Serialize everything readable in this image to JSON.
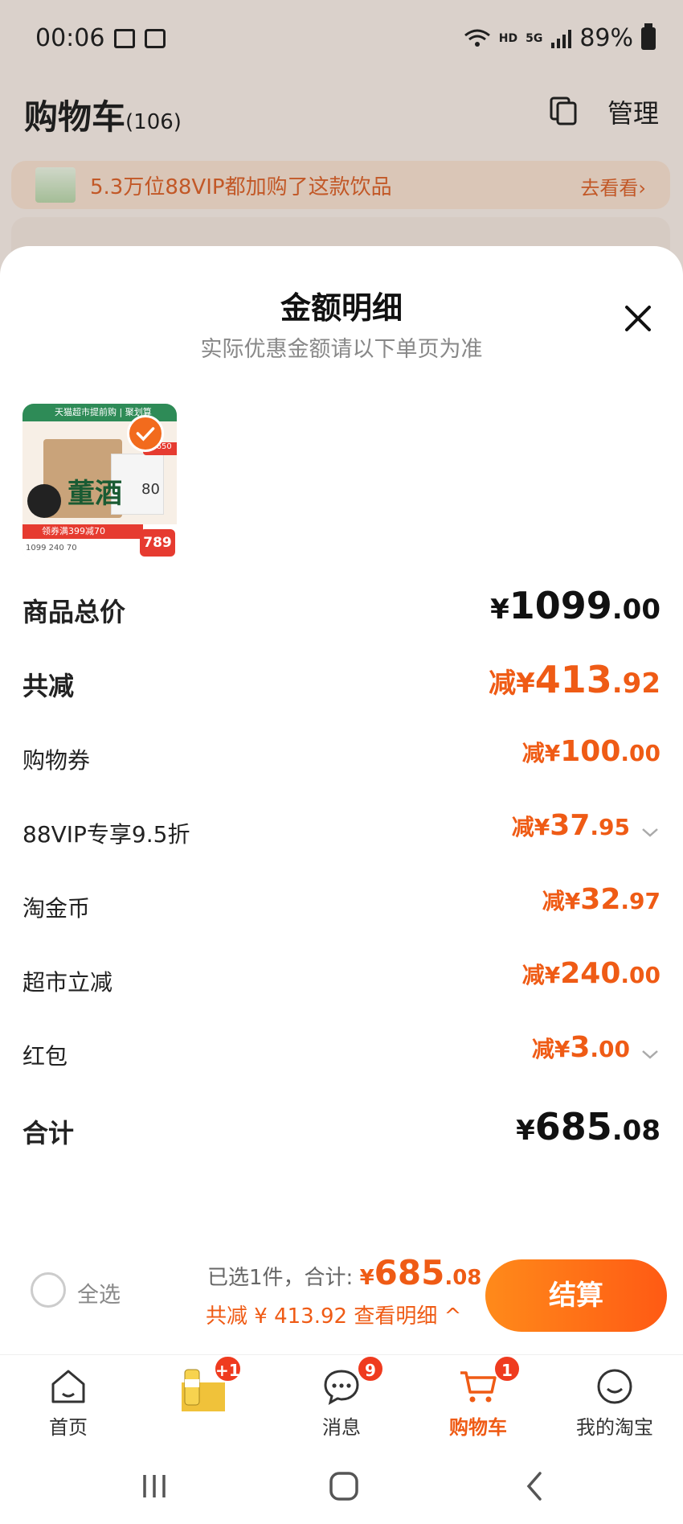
{
  "status": {
    "time": "00:06",
    "network": "HD",
    "signal": "5G",
    "battery": "89%"
  },
  "cart": {
    "title": "购物车",
    "count": "(106)",
    "manage": "管理"
  },
  "banner": {
    "text": "5.3万位88VIP都加购了这款饮品",
    "link": "去看看›"
  },
  "sheet": {
    "title": "金额明细",
    "subtitle": "实际优惠金额请以下单页为准",
    "product": {
      "top_text": "天猫超市提前购 | 聚划算",
      "brand": "董酒",
      "tag": "¥650",
      "eighty": "80",
      "coupon": "领券满399减70",
      "nums": "1099   240   70",
      "price": "789"
    },
    "rows": [
      {
        "label": "商品总价",
        "prefix": "",
        "currency": "¥",
        "main": "1099",
        "cents": ".00"
      },
      {
        "label": "共减",
        "prefix": "减",
        "currency": "¥",
        "main": "413",
        "cents": ".92"
      },
      {
        "label": "购物券",
        "prefix": "减",
        "currency": "¥",
        "main": "100",
        "cents": ".00"
      },
      {
        "label": "88VIP专享9.5折",
        "prefix": "减",
        "currency": "¥",
        "main": "37",
        "cents": ".95"
      },
      {
        "label": "淘金币",
        "prefix": "减",
        "currency": "¥",
        "main": "32",
        "cents": ".97"
      },
      {
        "label": "超市立减",
        "prefix": "减",
        "currency": "¥",
        "main": "240",
        "cents": ".00"
      },
      {
        "label": "红包",
        "prefix": "减",
        "currency": "¥",
        "main": "3",
        "cents": ".00"
      },
      {
        "label": "合计",
        "prefix": "",
        "currency": "¥",
        "main": "685",
        "cents": ".08"
      }
    ]
  },
  "summary": {
    "select_all": "全选",
    "selected": "已选1件，合计:",
    "currency": "¥",
    "total_main": "685",
    "total_cents": ".08",
    "discount": "共减 ¥ 413.92",
    "detail_link": "查看明细 ^",
    "checkout": "结算"
  },
  "tabs": [
    {
      "label": "首页",
      "icon": "home-icon",
      "badge": ""
    },
    {
      "label": "",
      "icon": "product-promo-icon",
      "badge": "+1"
    },
    {
      "label": "消息",
      "icon": "message-icon",
      "badge": "9"
    },
    {
      "label": "购物车",
      "icon": "cart-icon",
      "badge": "1"
    },
    {
      "label": "我的淘宝",
      "icon": "profile-icon",
      "badge": ""
    }
  ],
  "colors": {
    "accent": "#ef5b15",
    "badge": "#ef3b1f"
  }
}
